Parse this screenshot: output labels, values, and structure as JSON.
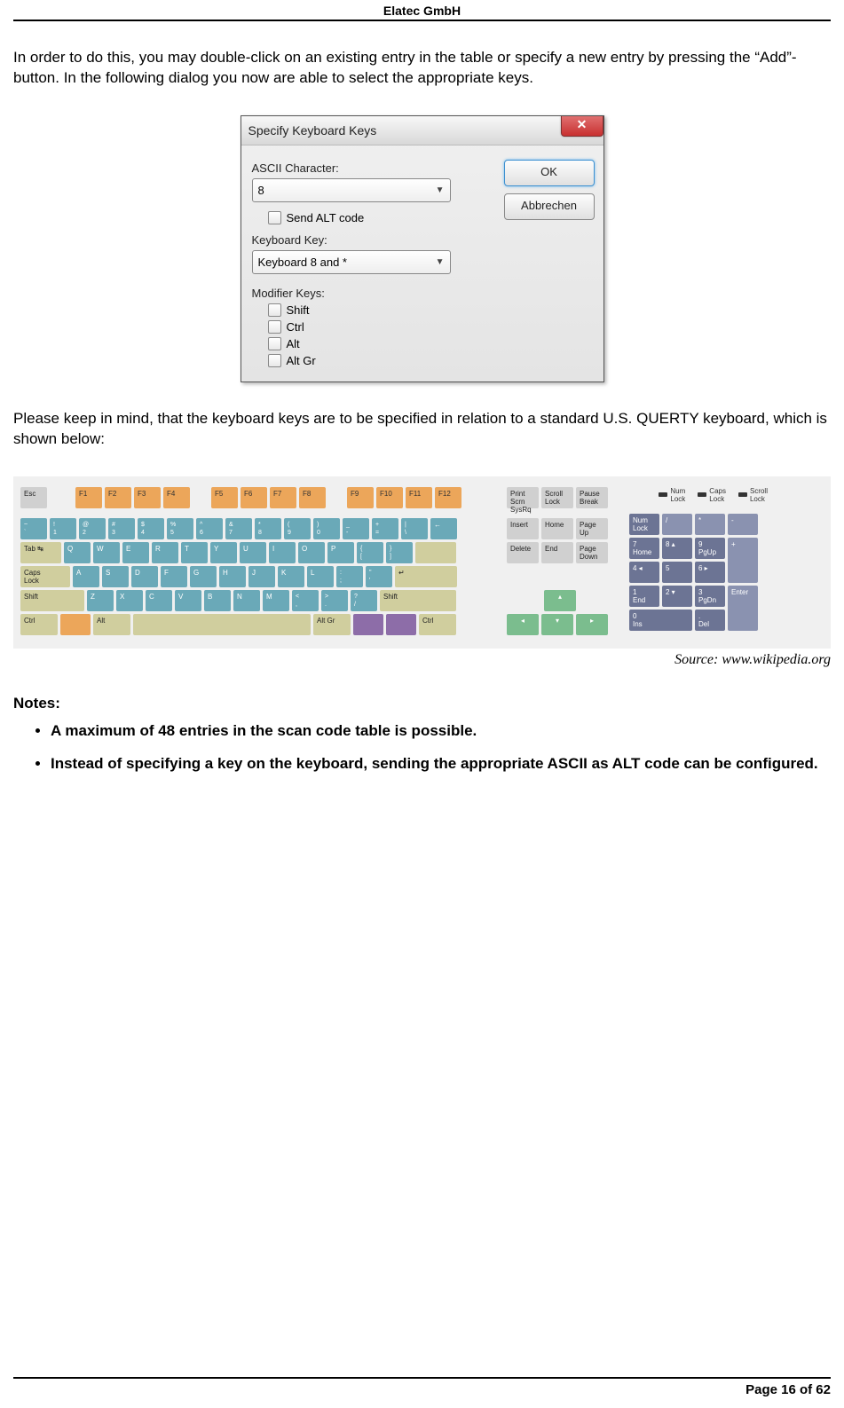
{
  "header": {
    "company": "Elatec GmbH"
  },
  "para1": "In order to do this, you may double-click on an existing entry in the table or specify a new entry by pressing the “Add”-button. In the following dialog you now are able to select the appropriate keys.",
  "dialog": {
    "title": "Specify Keyboard Keys",
    "ascii_label": "ASCII Character:",
    "ascii_value": "8",
    "send_alt": "Send ALT code",
    "kbkey_label": "Keyboard Key:",
    "kbkey_value": "Keyboard 8 and *",
    "mod_label": "Modifier Keys:",
    "mod_shift": "Shift",
    "mod_ctrl": "Ctrl",
    "mod_alt": "Alt",
    "mod_altgr": "Alt Gr",
    "ok": "OK",
    "cancel": "Abbrechen"
  },
  "para2": "Please keep in mind, that the keyboard keys are to be specified in relation to a standard U.S. QUERTY keyboard, which is shown below:",
  "keyboard": {
    "esc": "Esc",
    "f_row": [
      "F1",
      "F2",
      "F3",
      "F4",
      "F5",
      "F6",
      "F7",
      "F8",
      "F9",
      "F10",
      "F11",
      "F12"
    ],
    "print": "Print\nScrn\nSysRq",
    "scroll": "Scroll\nLock",
    "pause": "Pause\nBreak",
    "lock_num": "Num\nLock",
    "lock_caps": "Caps\nLock",
    "lock_scroll": "Scroll\nLock",
    "num_top": [
      [
        "~",
        "`"
      ],
      [
        "!",
        "1"
      ],
      [
        "@",
        "2"
      ],
      [
        "#",
        "3"
      ],
      [
        "$",
        "4"
      ],
      [
        "%",
        "5"
      ],
      [
        "^",
        "6"
      ],
      [
        "&",
        "7"
      ],
      [
        "*",
        "8"
      ],
      [
        "(",
        "9"
      ],
      [
        ")",
        "0"
      ],
      [
        "_",
        "-"
      ],
      [
        "+",
        "="
      ],
      [
        "|",
        "\\"
      ]
    ],
    "backspace": "←",
    "tab": "Tab ↹",
    "qrow": [
      "Q",
      "W",
      "E",
      "R",
      "T",
      "Y",
      "U",
      "I",
      "O",
      "P"
    ],
    "brackets": [
      [
        "{",
        "["
      ],
      [
        "}",
        "]"
      ]
    ],
    "caps": "Caps\nLock",
    "arow": [
      "A",
      "S",
      "D",
      "F",
      "G",
      "H",
      "J",
      "K",
      "L"
    ],
    "semi": [
      ":",
      ";"
    ],
    "quote": [
      "\"",
      "'"
    ],
    "enter_arrow": "↵",
    "shift": "Shift",
    "zrow": [
      "Z",
      "X",
      "C",
      "V",
      "B",
      "N",
      "M"
    ],
    "comma": [
      "<",
      ","
    ],
    "period": [
      ">",
      "."
    ],
    "slash": [
      "?",
      "/"
    ],
    "ctrl": "Ctrl",
    "alt": "Alt",
    "altgr": "Alt Gr",
    "insert": "Insert",
    "home": "Home",
    "pgup": "Page\nUp",
    "delete": "Delete",
    "end": "End",
    "pgdn": "Page\nDown",
    "up": "▴",
    "left": "◂",
    "down": "▾",
    "right": "▸",
    "numlock": "Num\nLock",
    "np": {
      "div": "/",
      "mul": "*",
      "sub": "-",
      "add": "+",
      "7": "7\nHome",
      "8": "8 ▴",
      "9": "9\nPgUp",
      "4": "4 ◂",
      "5": "5",
      "6": "6 ▸",
      "1": "1\nEnd",
      "2": "2 ▾",
      "3": "3\nPgDn",
      "0": "0\nIns",
      "dot": ".\nDel",
      "enter": "Enter"
    }
  },
  "source": "Source: www.wikipedia.org",
  "notes": {
    "heading": "Notes:",
    "items": [
      "A maximum of 48 entries in the scan code table is possible.",
      "Instead of specifying a key on the keyboard, sending the appropriate ASCII as ALT code can be configured."
    ]
  },
  "footer": "Page 16 of 62"
}
